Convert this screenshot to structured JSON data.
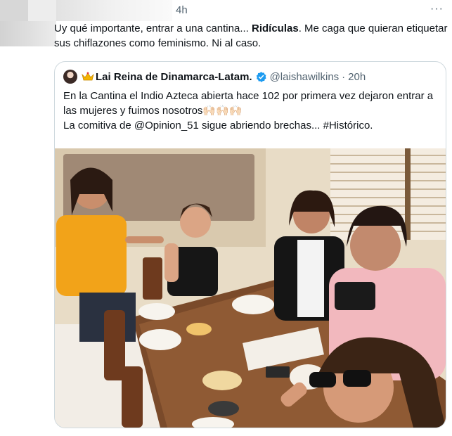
{
  "tweet": {
    "time": "4h",
    "more_label": "···",
    "text_before": "Uy qué importante, entrar a una cantina... ",
    "text_bold": "Ridículas",
    "text_after": ". Me caga que quieran etiquetar sus chiflazones como feminismo. Ni al caso."
  },
  "quote": {
    "display_name": "Lai Reina de Dinamarca-Latam.",
    "handle": "@laishawilkins",
    "separator": "·",
    "time": "20h",
    "line1": "En la Cantina el Indio Azteca abierta hace 102 por primera vez dejaron entrar a las mujeres y fuimos nosotros",
    "line1_emoji": "🙌🏻🙌🏻🙌🏻",
    "line2": "La comitiva de @Opinion_51 sigue abriendo brechas... #Histórico."
  },
  "colors": {
    "text": "#0f1419",
    "muted": "#536471",
    "verified": "#1d9bf0",
    "border": "#cfd9de"
  },
  "icons": [
    "more-icon",
    "crown-icon",
    "verified-badge-icon"
  ]
}
